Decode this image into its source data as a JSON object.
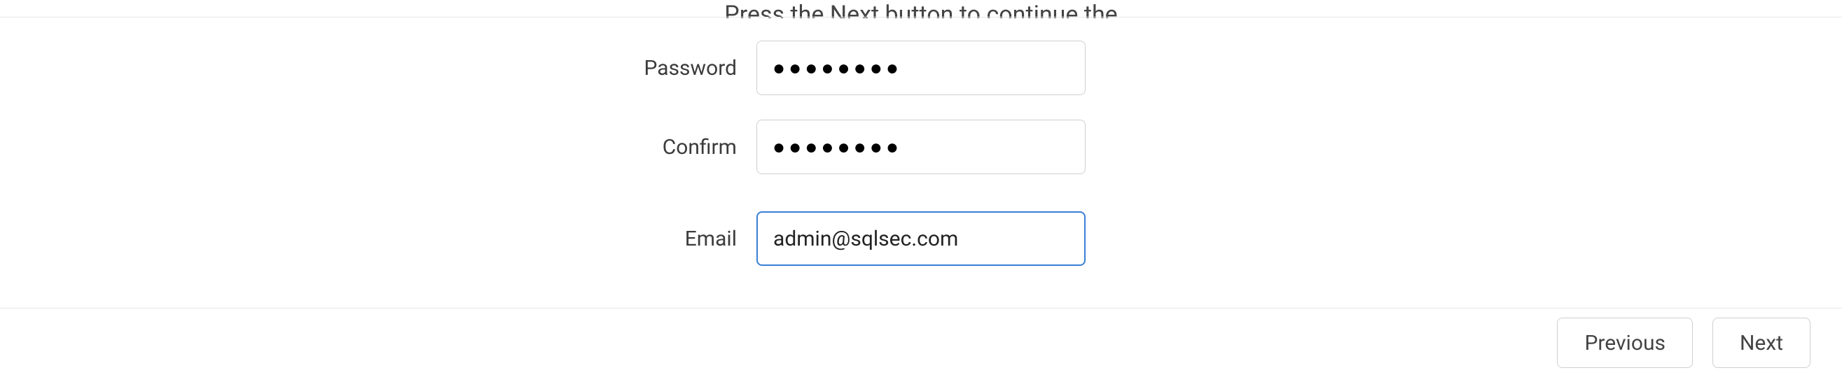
{
  "hint": "Press the Next button to continue the",
  "form": {
    "password": {
      "label": "Password",
      "mask": "●●●●●●●●"
    },
    "confirm": {
      "label": "Confirm",
      "mask": "●●●●●●●●"
    },
    "email": {
      "label": "Email",
      "value": "admin@sqlsec.com"
    }
  },
  "buttons": {
    "previous": "Previous",
    "next": "Next"
  }
}
